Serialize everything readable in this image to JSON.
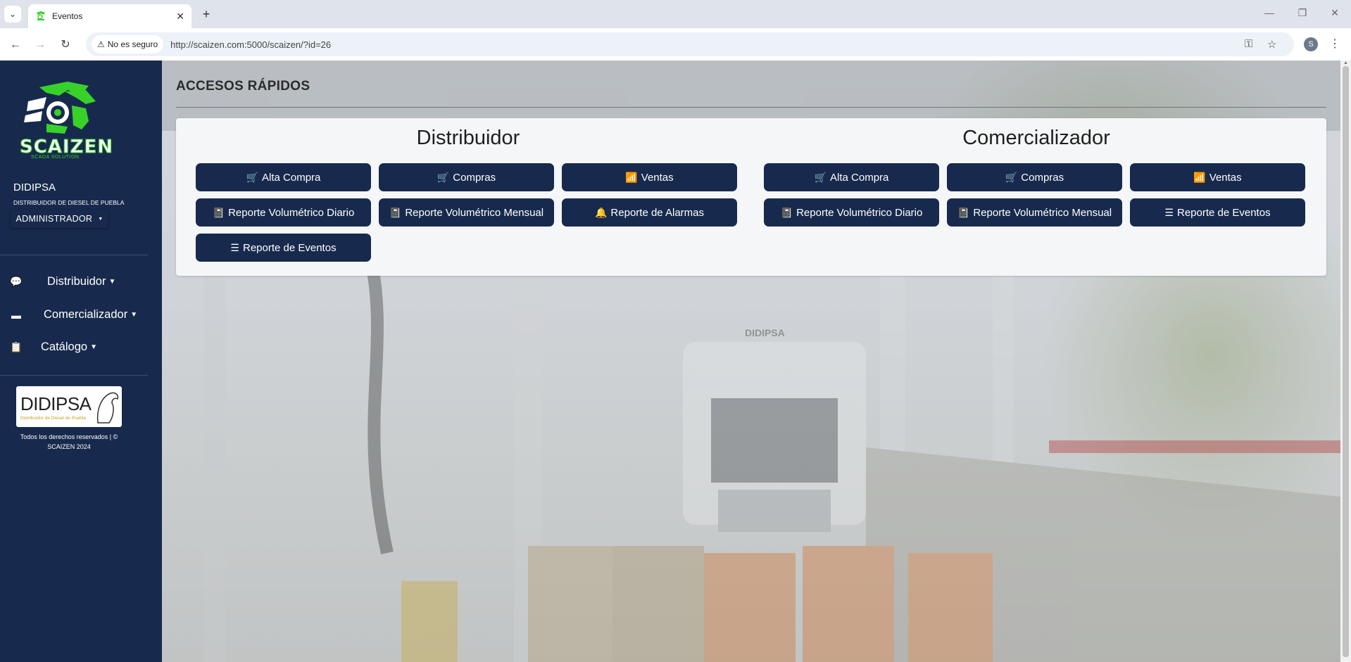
{
  "browser": {
    "tab_title": "Eventos",
    "security_label": "No es seguro",
    "url": "http://scaizen.com:5000/scaizen/?id=26",
    "profile_initial": "S"
  },
  "sidebar": {
    "logo_text": "SCAIZEN",
    "logo_sub": "SCADA SOLUTION",
    "company": "DIDIPSA",
    "company_desc": "DISTRIBUIDOR DE DIESEL DE PUEBLA",
    "role": "ADMINISTRADOR",
    "nav": [
      {
        "label": "Distribuidor",
        "icon": "comments-icon"
      },
      {
        "label": "Comercializador",
        "icon": "card-icon"
      },
      {
        "label": "Catálogo",
        "icon": "clipboard-icon"
      }
    ],
    "partner_name": "DIDIPSA",
    "partner_tag": "Distribuidor de Diesel de Puebla",
    "footer": "Todos los derechos reservados | © SCAIZEN 2024"
  },
  "main": {
    "title": "ACCESOS RÁPIDOS",
    "distribuidor": {
      "title": "Distribuidor",
      "buttons": [
        {
          "label": "Alta Compra",
          "icon": "cart-icon"
        },
        {
          "label": "Compras",
          "icon": "cart-icon"
        },
        {
          "label": "Ventas",
          "icon": "chart-icon"
        },
        {
          "label": "Reporte Volumétrico Diario",
          "icon": "book-icon"
        },
        {
          "label": "Reporte Volumétrico Mensual",
          "icon": "book-icon"
        },
        {
          "label": "Reporte de Alarmas",
          "icon": "bell-icon"
        },
        {
          "label": "Reporte de Eventos",
          "icon": "list-icon"
        }
      ]
    },
    "comercializador": {
      "title": "Comercializador",
      "buttons": [
        {
          "label": "Alta Compra",
          "icon": "cart-icon"
        },
        {
          "label": "Compras",
          "icon": "cart-icon"
        },
        {
          "label": "Ventas",
          "icon": "chart-icon"
        },
        {
          "label": "Reporte Volumétrico Diario",
          "icon": "book-icon"
        },
        {
          "label": "Reporte Volumétrico Mensual",
          "icon": "book-icon"
        },
        {
          "label": "Reporte de Eventos",
          "icon": "list-icon"
        }
      ]
    },
    "photo_sign_text": "DIDIPSA"
  },
  "colors": {
    "primary": "#172a4d",
    "accent_green": "#38d12a"
  }
}
